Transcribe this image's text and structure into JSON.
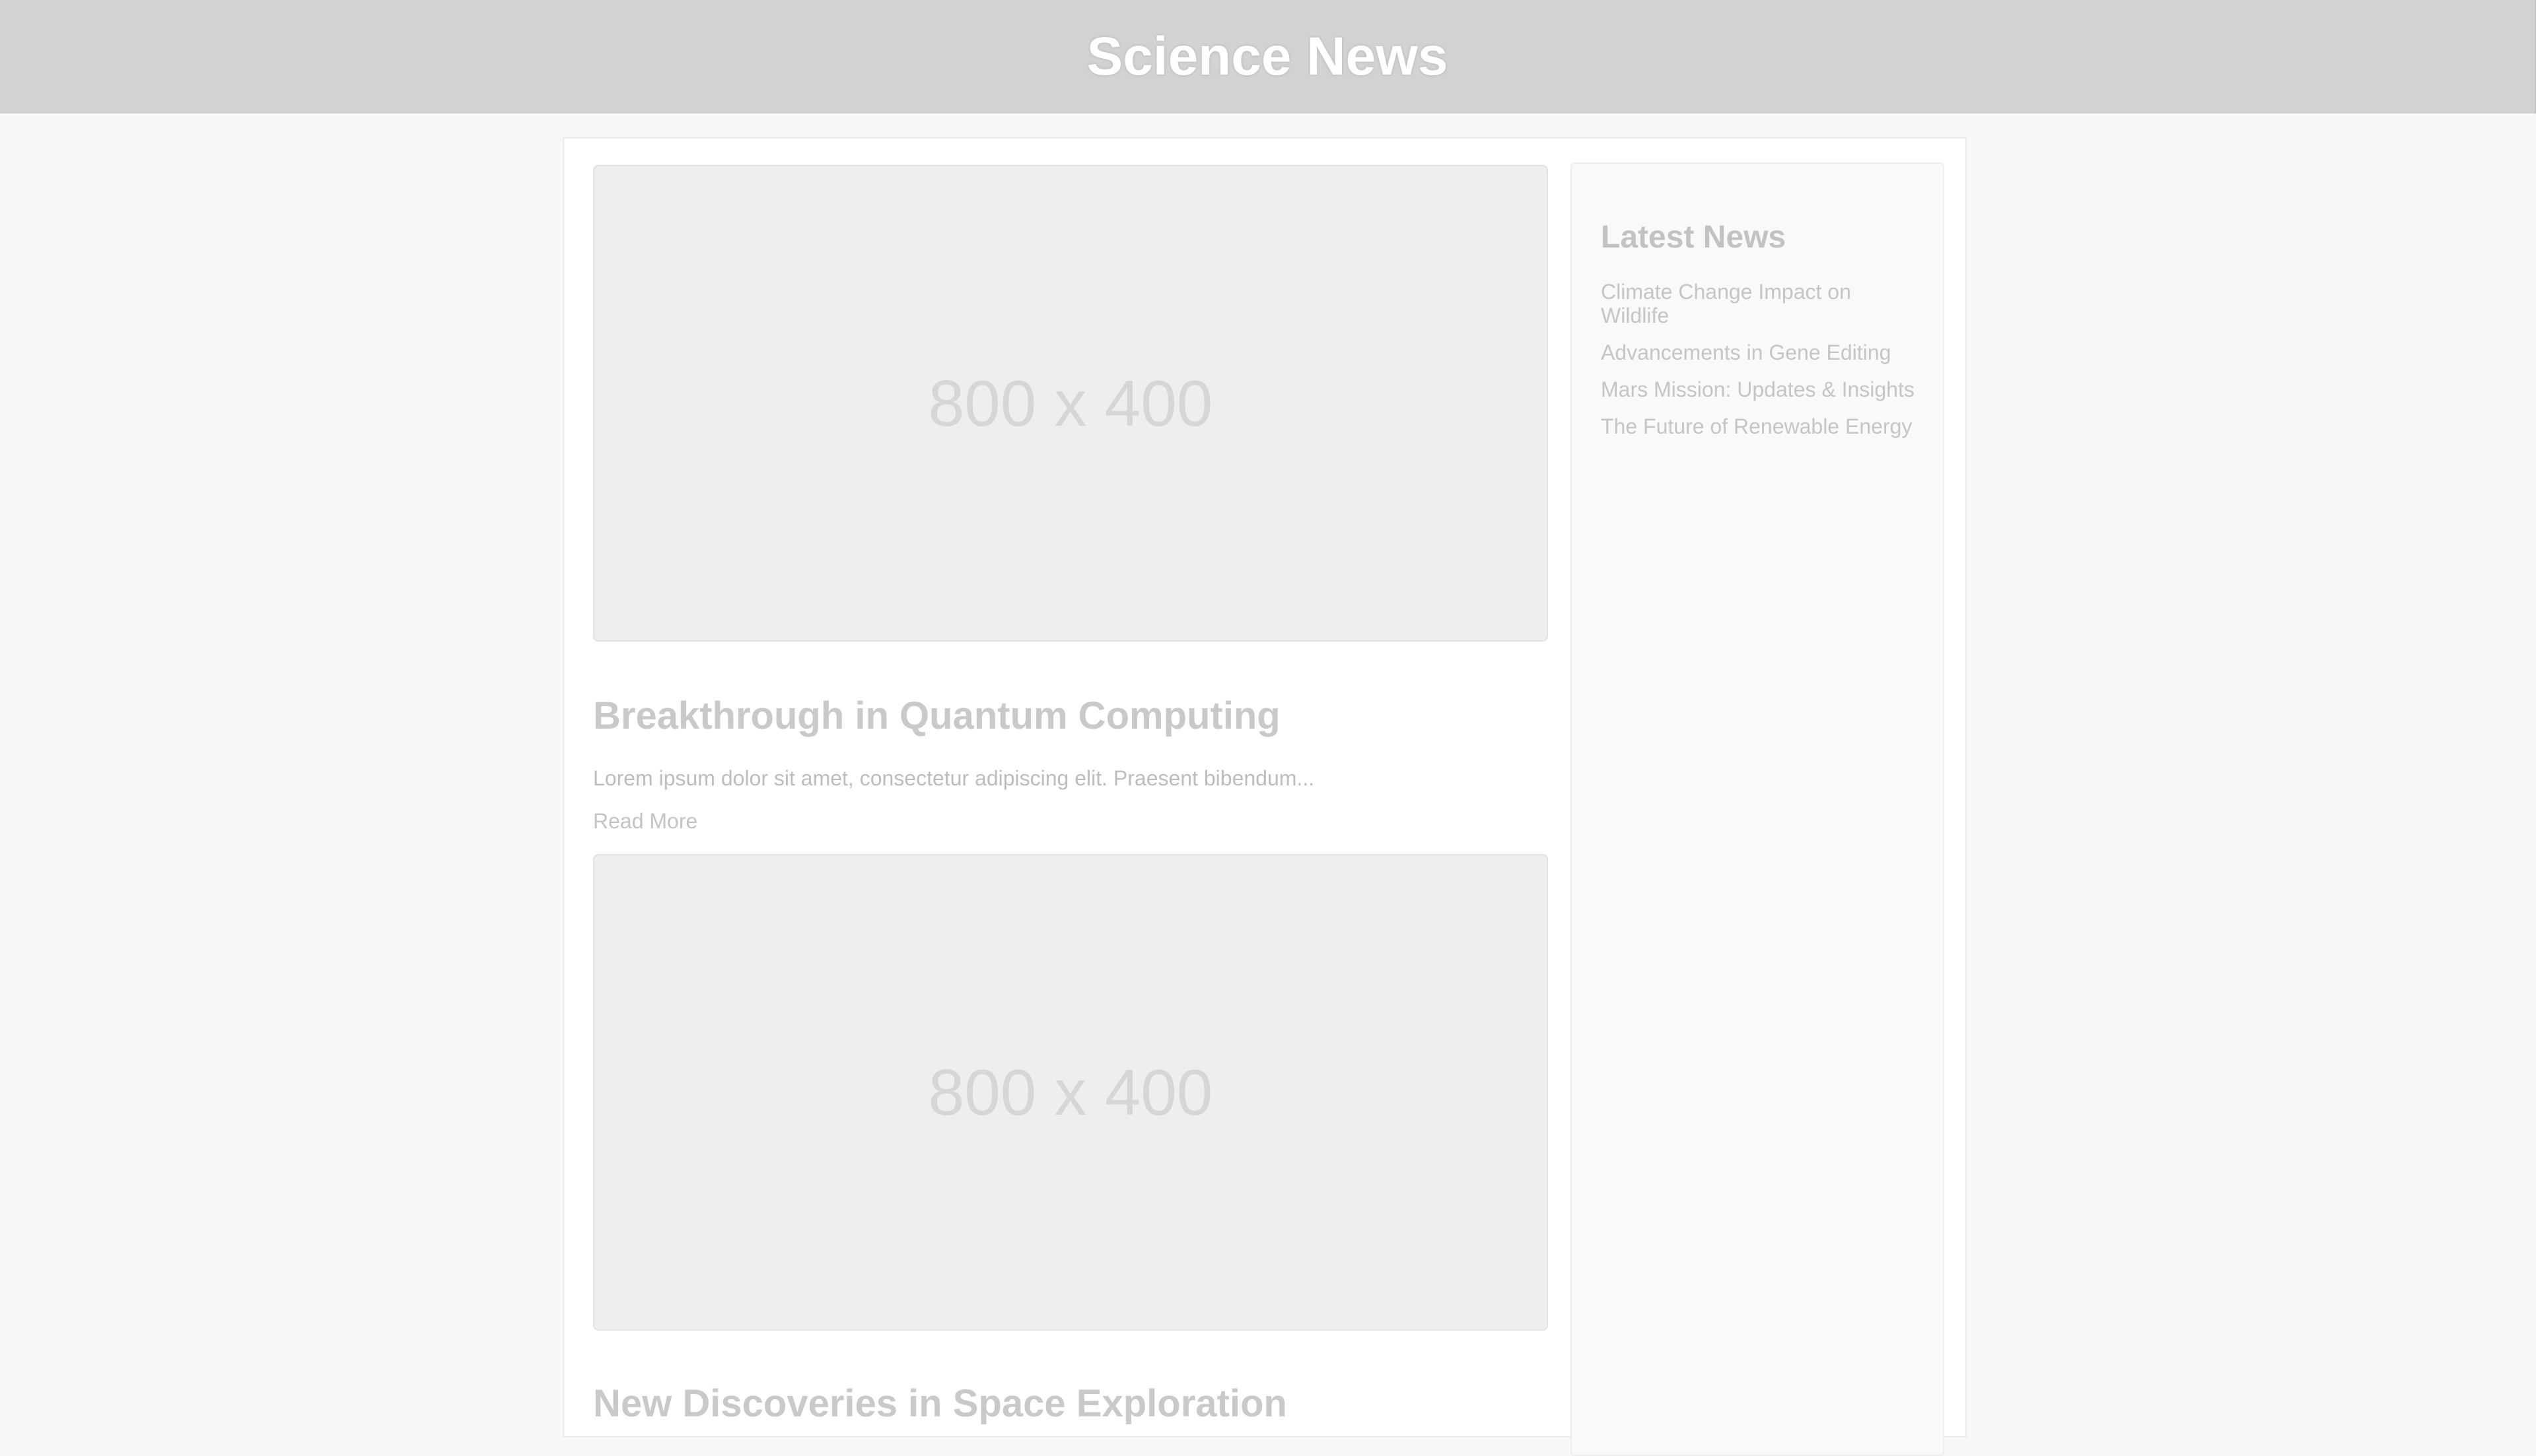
{
  "header": {
    "title": "Science News"
  },
  "articles": [
    {
      "image_placeholder": "800 x 400",
      "title": "Breakthrough in Quantum Computing",
      "excerpt": "Lorem ipsum dolor sit amet, consectetur adipiscing elit. Praesent bibendum...",
      "read_more": "Read More"
    },
    {
      "image_placeholder": "800 x 400",
      "title": "New Discoveries in Space Exploration"
    }
  ],
  "sidebar": {
    "title": "Latest News",
    "items": [
      {
        "label": "Climate Change Impact on Wildlife"
      },
      {
        "label": "Advancements in Gene Editing"
      },
      {
        "label": "Mars Mission: Updates & Insights"
      },
      {
        "label": "The Future of Renewable Energy"
      }
    ]
  }
}
